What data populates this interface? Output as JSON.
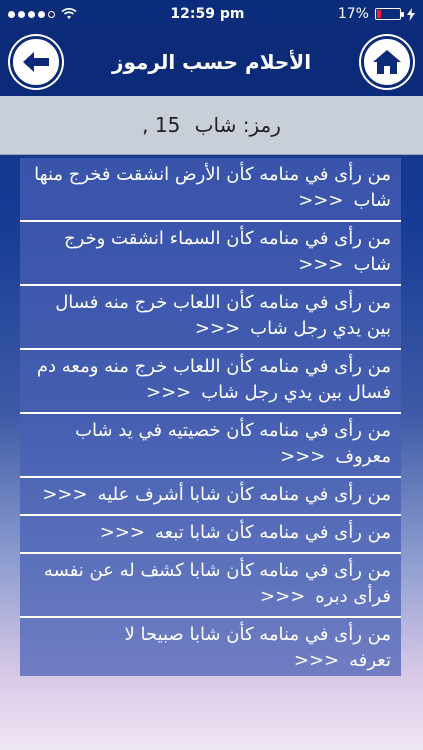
{
  "status_bar": {
    "carrier_signal": "●●●●○",
    "time": "12:59 pm",
    "battery": "17%",
    "battery_level": 0.17
  },
  "header": {
    "title": "الأحلام حسب الرموز"
  },
  "symbol_bar": {
    "label": "رمز:",
    "symbol": "شاب",
    "count": ", 15"
  },
  "dreams": [
    "من رأى في منامه كأن الأرض انشقت فخرج منها شاب",
    "من رأى في منامه كأن السماء انشقت وخرج شاب",
    "من رأى في منامه كأن اللعاب خرج منه فسال بين يدي رجل شاب",
    "من رأى في منامه كأن اللعاب خرج منه ومعه دم فسال بين يدي رجل شاب",
    "من رأى في منامه كأن خصيتيه في يد شاب معروف",
    "من رأى في منامه كأن شابا أشرف عليه",
    "من رأى في منامه كأن شابا تبعه",
    "من رأى في منامه كأن شابا كشف له عن نفسه فرأى دبره",
    "من رأى في منامه كأن شابا صبيحا لا تعرفه"
  ],
  "more_marker": ">>>"
}
